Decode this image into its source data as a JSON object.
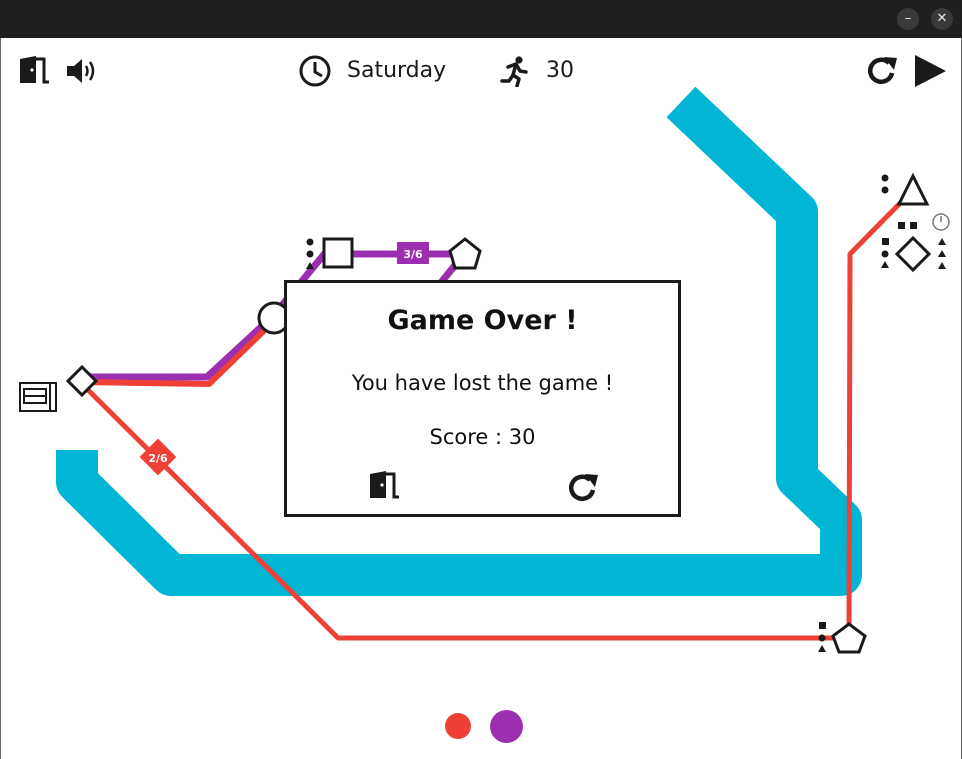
{
  "window": {
    "minimize_glyph": "–",
    "close_glyph": "✕"
  },
  "hud": {
    "exit_icon": "door-exit-icon",
    "sound_icon": "speaker-icon",
    "clock_icon": "clock-icon",
    "day": "Saturday",
    "passenger_icon": "runner-icon",
    "passengers": "30",
    "restart_icon": "restart-icon",
    "play_icon": "play-icon"
  },
  "lines": [
    {
      "name": "red",
      "color": "#ee4035",
      "label": "2/6"
    },
    {
      "name": "purple",
      "color": "#9c2fb0",
      "label": "3/6"
    }
  ],
  "river_color": "#00b6d4",
  "stations": [
    "square",
    "pentagon",
    "circle",
    "diamond",
    "triangle",
    "diamond",
    "pentagon"
  ],
  "dialog": {
    "title": "Game Over !",
    "message": "You have lost the game !",
    "score": "Score : 30",
    "exit_icon": "door-exit-icon",
    "restart_icon": "restart-icon"
  }
}
